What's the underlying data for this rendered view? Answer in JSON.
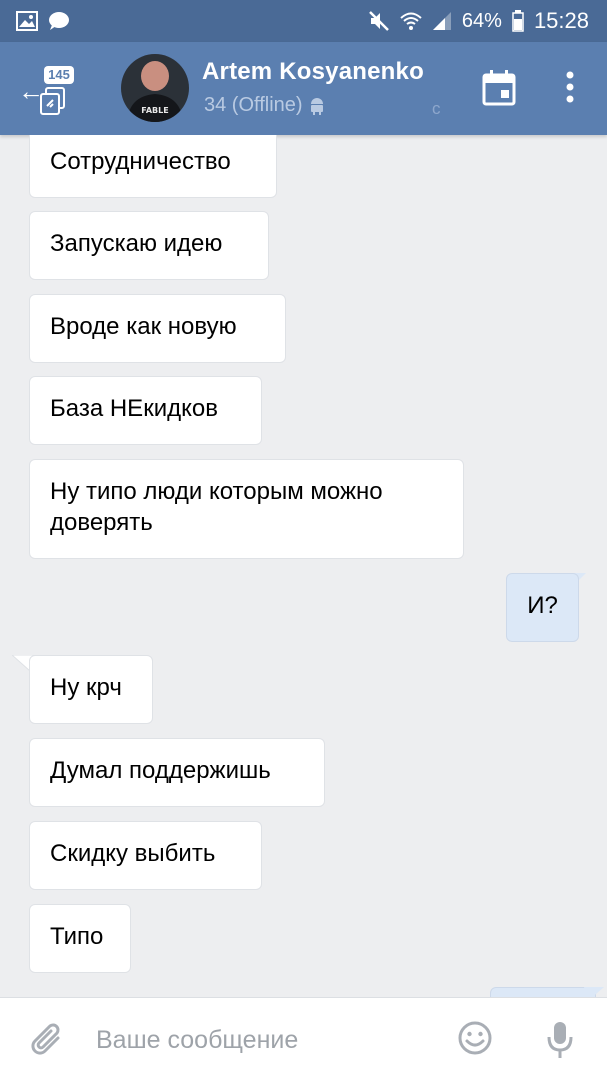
{
  "status_bar": {
    "battery_percent": "64%",
    "time": "15:28",
    "icons": [
      "image-icon",
      "chat-bubble-icon",
      "mute-icon",
      "wifi-icon",
      "signal-icon",
      "battery-icon"
    ]
  },
  "header": {
    "unread_count": "145",
    "contact_name": "Artem Kosyanenko",
    "contact_status": "34 (Offline)",
    "status_suffix": "с",
    "avatar_text": "FABLE",
    "icons": [
      "back-arrow-icon",
      "dialogs-icon",
      "android-icon",
      "calendar-icon",
      "more-vertical-icon"
    ]
  },
  "messages": [
    {
      "text": "Сотрудничество",
      "direction": "in"
    },
    {
      "text": "Запускаю идею",
      "direction": "in"
    },
    {
      "text": "Вроде как новую",
      "direction": "in"
    },
    {
      "text": "База НЕкидков",
      "direction": "in"
    },
    {
      "text": "Ну типо люди которым можно доверять",
      "direction": "in"
    },
    {
      "text": "И?",
      "direction": "out"
    },
    {
      "text": "Ну крч",
      "direction": "in"
    },
    {
      "text": "Думал поддержишь",
      "direction": "in"
    },
    {
      "text": "Скидку выбить",
      "direction": "in"
    },
    {
      "text": "Типо",
      "direction": "in"
    }
  ],
  "composer": {
    "placeholder": "Ваше сообщение",
    "icons": [
      "paperclip-icon",
      "emoji-icon",
      "microphone-icon"
    ]
  },
  "colors": {
    "status_bar": "#4a6a96",
    "header": "#5b7fb0",
    "chat_background": "#edeef0",
    "incoming_bubble": "#ffffff",
    "outgoing_bubble": "#dce8f7"
  }
}
